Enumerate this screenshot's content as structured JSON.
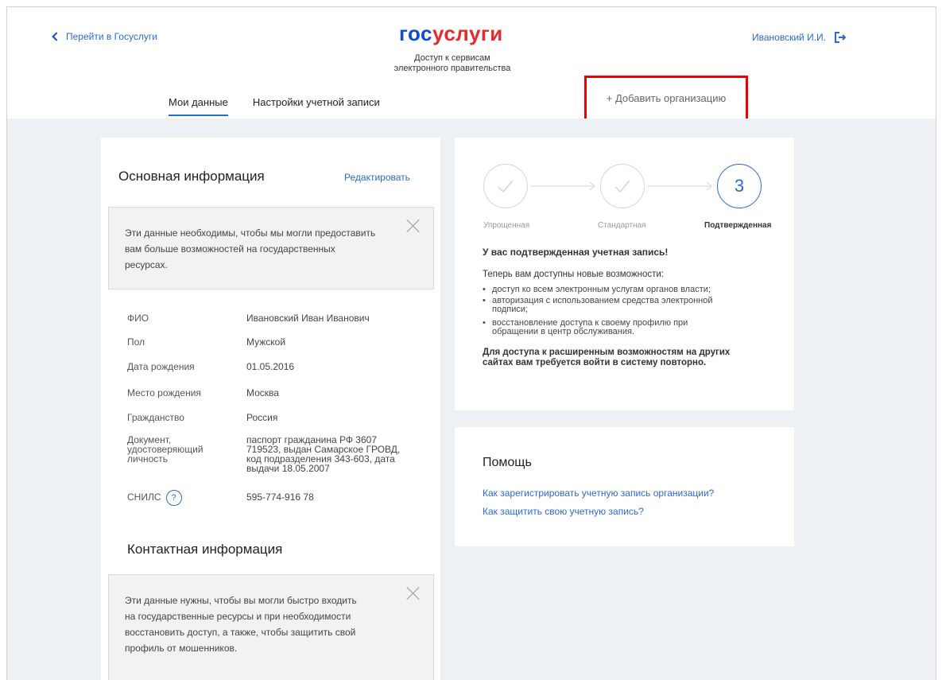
{
  "header": {
    "back_label": "Перейти в Госуслуги",
    "logo_part1": "гос",
    "logo_part2": "услуги",
    "subtitle_line1": "Доступ к сервисам",
    "subtitle_line2": "электронного правительства",
    "user_name": "Ивановский И.И."
  },
  "tabs": [
    {
      "label": "Мои данные",
      "active": true
    },
    {
      "label": "Настройки учетной записи",
      "active": false
    }
  ],
  "add_org_label": "+ Добавить организацию",
  "main_info": {
    "title": "Основная информация",
    "edit_label": "Редактировать",
    "notice_line1": "Эти данные необходимы, чтобы мы могли предоставить",
    "notice_line2": "вам больше возможностей на государственных",
    "notice_line3": "ресурсах.",
    "fields": [
      {
        "label": "ФИО",
        "value": "Ивановский Иван Иванович"
      },
      {
        "label": "Пол",
        "value": "Мужской"
      },
      {
        "label": "Дата рождения",
        "value": "01.05.2016"
      },
      {
        "label": "Место рождения",
        "value": "Москва"
      },
      {
        "label": "Гражданство",
        "value": "Россия"
      }
    ],
    "document_label_l1": "Документ,",
    "document_label_l2": "удостоверяющий",
    "document_label_l3": "личность",
    "document_value_l1": "паспорт гражданина РФ 3607",
    "document_value_l2": "719523, выдан Самарское ГРОВД,",
    "document_value_l3": "код подразделения 343-603, дата",
    "document_value_l4": "выдачи 18.05.2007",
    "snils_label": "СНИЛС",
    "snils_help": "?",
    "snils_value": "595-774-916 78"
  },
  "contact_info": {
    "title": "Контактная информация",
    "notice_line1": "Эти данные нужны, чтобы вы могли быстро входить",
    "notice_line2": "на государственные ресурсы и при необходимости",
    "notice_line3": "восстановить доступ, а также, чтобы защитить свой",
    "notice_line4": "профиль от мошенников."
  },
  "account_status": {
    "steps": [
      {
        "label": "Упрощенная",
        "done": true
      },
      {
        "label": "Стандартная",
        "done": true
      },
      {
        "label": "Подтвержденная",
        "number": "3"
      }
    ],
    "heading": "У вас подтвержденная учетная запись!",
    "intro": "Теперь вам доступны новые возможности:",
    "bullet1": "доступ ко всем электронным услугам органов власти;",
    "bullet2_l1": "авторизация с использованием средства электронной",
    "bullet2_l2": "подписи;",
    "bullet3_l1": "восстановление доступа к своему профилю при",
    "bullet3_l2": "обращении в центр обслуживания.",
    "note_l1": "Для доступа к расширенным возможностям на других",
    "note_l2": "сайтах вам требуется войти в систему повторно."
  },
  "help": {
    "title": "Помощь",
    "link1": "Как зарегистрировать учетную запись организации?",
    "link2": "Как защитить свою учетную запись?"
  },
  "colors": {
    "accent": "#2b6ad0",
    "logo_blue": "#0d4cd3",
    "logo_red": "#e42b2b",
    "highlight_border": "#e00000",
    "page_bg": "#eef1f4"
  }
}
